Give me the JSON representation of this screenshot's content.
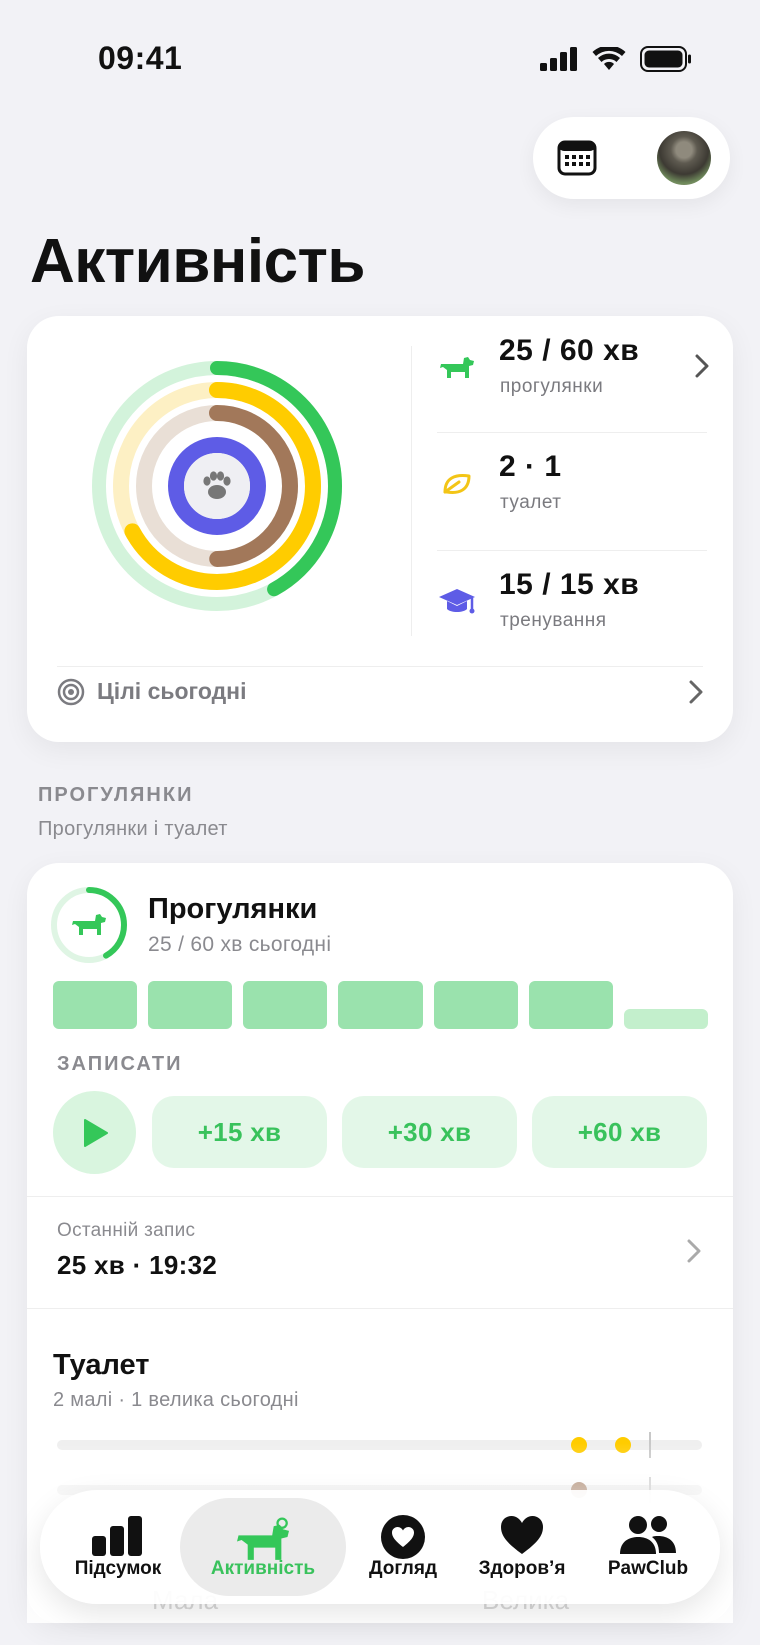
{
  "status_bar": {
    "time": "09:41"
  },
  "page": {
    "title": "Активність"
  },
  "summary": {
    "metrics": [
      {
        "value": "25 / 60 хв",
        "label": "прогулянки",
        "icon": "dog-icon"
      },
      {
        "value": "2 · 1",
        "label": "туалет",
        "icon": "leaf-icon"
      },
      {
        "value": "15 / 15 хв",
        "label": "тренування",
        "icon": "graduation-cap-icon"
      }
    ],
    "goals_label": "Цілі сьогодні",
    "rings": [
      {
        "name": "walks",
        "color": "#34c759",
        "progress": 0.42
      },
      {
        "name": "toilet_small",
        "color": "#ffcc00",
        "progress": 0.67
      },
      {
        "name": "toilet_big",
        "color": "#a2785a",
        "progress": 0.5
      },
      {
        "name": "training",
        "color": "#5e5ce6",
        "progress": 1.0
      }
    ]
  },
  "section": {
    "heading": "ПРОГУЛЯНКИ",
    "subheading": "Прогулянки і туалет"
  },
  "walks": {
    "title": "Прогулянки",
    "subtitle": "25 / 60 хв сьогодні",
    "progress": 0.42,
    "record_label": "ЗАПИСАТИ",
    "buttons": [
      "+15 хв",
      "+30 хв",
      "+60 хв"
    ],
    "last_label": "Останній запис",
    "last_value": "25 хв · 19:32"
  },
  "toilet": {
    "title": "Туалет",
    "subtitle": "2 малі · 1 велика сьогодні",
    "ghost_left": "Мала",
    "ghost_right": "Велика"
  },
  "tabs": [
    {
      "label": "Підсумок",
      "icon": "chart-bars-icon",
      "active": false
    },
    {
      "label": "Активність",
      "icon": "dog-icon",
      "active": true
    },
    {
      "label": "Догляд",
      "icon": "heart-circle-icon",
      "active": false
    },
    {
      "label": "Здоров’я",
      "icon": "heart-icon",
      "active": false
    },
    {
      "label": "PawClub",
      "icon": "people-icon",
      "active": false
    }
  ],
  "colors": {
    "accent_green": "#34c759",
    "yellow": "#ffcc00",
    "brown": "#a2785a",
    "purple": "#5e5ce6"
  }
}
